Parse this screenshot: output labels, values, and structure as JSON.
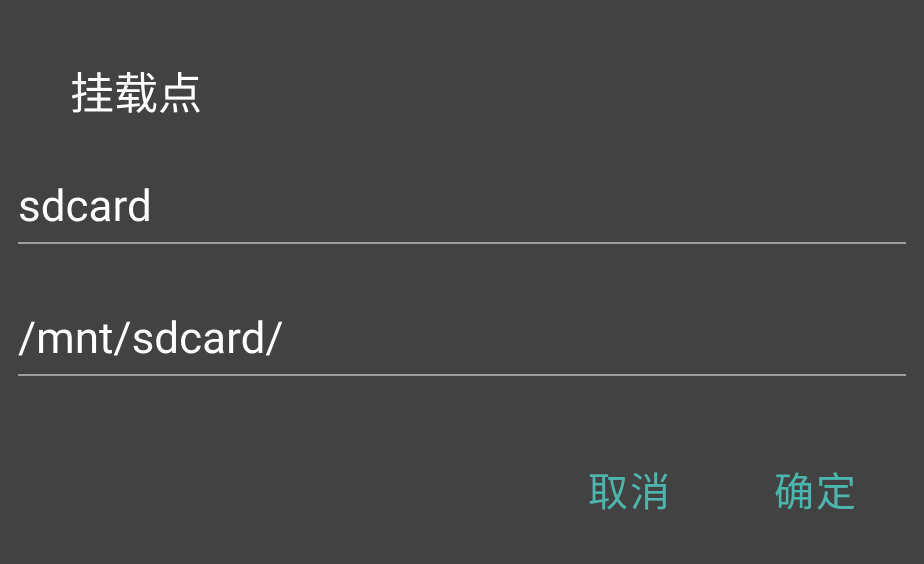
{
  "dialog": {
    "title": "挂载点",
    "name_input": "sdcard",
    "path_input": "/mnt/sdcard/",
    "cancel_label": "取消",
    "confirm_label": "确定"
  }
}
